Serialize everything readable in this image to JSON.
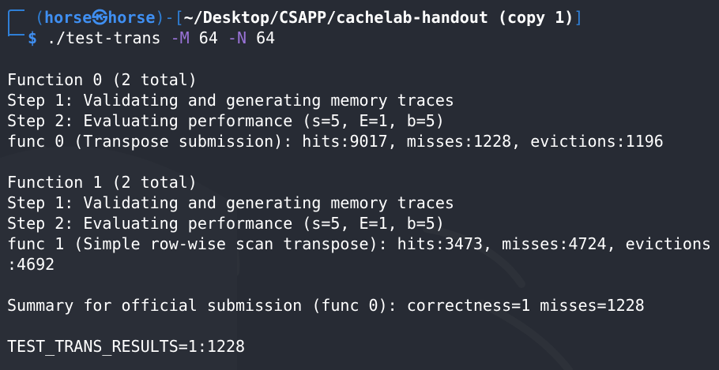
{
  "prompt": {
    "user": "horse",
    "host": "horse",
    "separator_icon": "kali-skull-icon",
    "path": "~/Desktop/CSAPP/cachelab-handout (copy 1)",
    "symbol": "$",
    "command": "./test-trans",
    "flag_m": "-M",
    "value_m": "64",
    "flag_n": "-N",
    "value_n": "64"
  },
  "output": {
    "lines": [
      "Function 0 (2 total)",
      "Step 1: Validating and generating memory traces",
      "Step 2: Evaluating performance (s=5, E=1, b=5)",
      "func 0 (Transpose submission): hits:9017, misses:1228, evictions:1196",
      "",
      "Function 1 (2 total)",
      "Step 1: Validating and generating memory traces",
      "Step 2: Evaluating performance (s=5, E=1, b=5)",
      "func 1 (Simple row-wise scan transpose): hits:3473, misses:4724, evictions",
      ":4692",
      "",
      "Summary for official submission (func 0): correctness=1 misses=1228",
      "",
      "TEST_TRANS_RESULTS=1:1228"
    ]
  },
  "colors": {
    "background": "#272b34",
    "prompt_blue": "#3f8ff2",
    "frame_blue": "#2f7fd6",
    "option_purple": "#9a73d8",
    "text": "#ffffff"
  }
}
